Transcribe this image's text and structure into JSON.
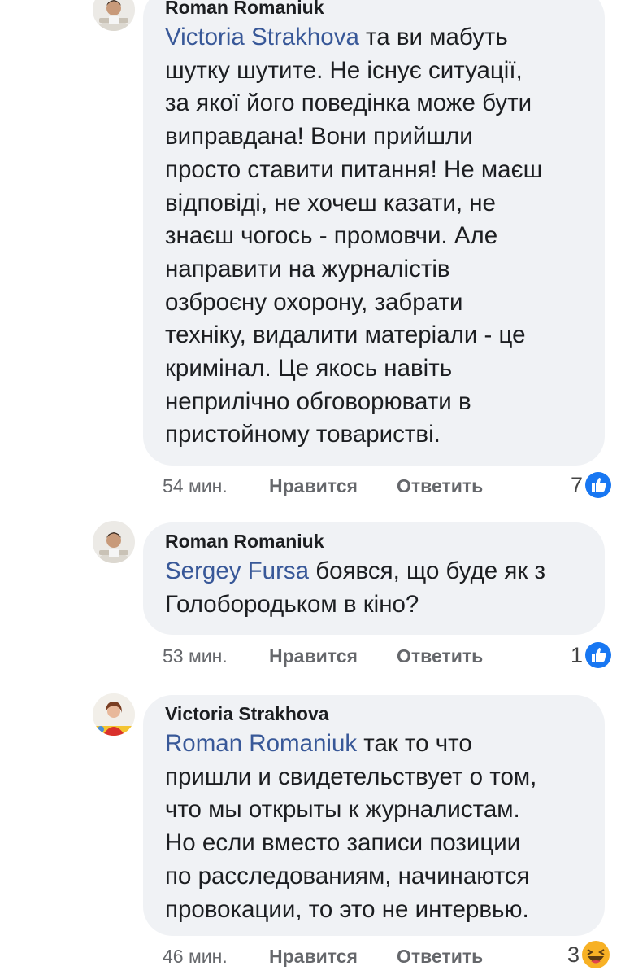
{
  "comments": [
    {
      "author": "Roman Romaniuk",
      "mention": "Victoria Strakhova",
      "body_first": " та ви мабуть",
      "body_rest": "шутку шутите. Не існує ситуації,\nза якої його поведінка може бути\nвиправдана! Вони прийшли\nпросто ставити питання! Не маєш\nвідповіді,  не хочеш казати, не\nзнаєш чогось - промовчи. Але\nнаправити на журналістів\nозброєну охорону, забрати\nтехніку, видалити матеріали - це\nкримінал. Це якось навіть\nнеприлічно обговорювати в\nпристойному товаристві.",
      "time": "54 мин.",
      "like_label": "Нравится",
      "reply_label": "Ответить",
      "reaction_count": "7",
      "reaction_icon": "like-icon"
    },
    {
      "author": "Roman Romaniuk",
      "mention": "Sergey Fursa",
      "body_first": " боявся, що буде як з",
      "body_rest": "Голобородьком в кіно?",
      "time": "53 мин.",
      "like_label": "Нравится",
      "reply_label": "Ответить",
      "reaction_count": "1",
      "reaction_icon": "like-icon"
    },
    {
      "author": "Victoria Strakhova",
      "mention": "Roman Romaniuk",
      "body_first": " так то что",
      "body_rest": "пришли и свидетельствует о том,\nчто мы открыты к журналистам.\nНо если вместо записи позиции\nпо расследованиям, начинаются\nпровокации, то это не интервью.",
      "time": "46 мин.",
      "like_label": "Нравится",
      "reply_label": "Ответить",
      "reaction_count": "3",
      "reaction_icon": "haha-icon"
    }
  ],
  "colors": {
    "bubble": "#f0f2f5",
    "mention": "#385898",
    "like_blue": "#1877f2",
    "haha_yellow": "#f7b125"
  }
}
